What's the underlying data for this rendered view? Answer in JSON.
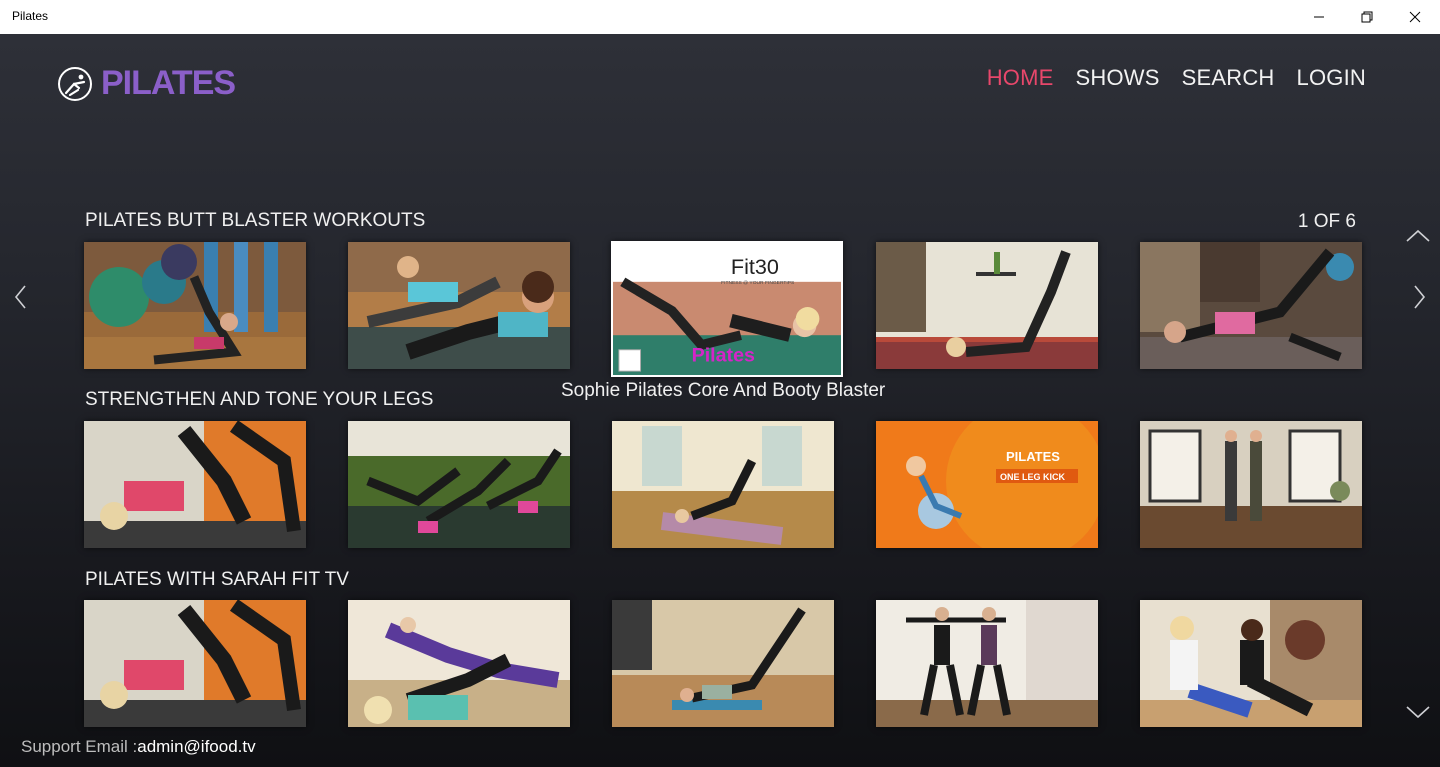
{
  "window": {
    "title": "Pilates"
  },
  "brand": {
    "name": "PILATES",
    "color": "#8b5fc9"
  },
  "nav": {
    "items": [
      {
        "label": "HOME",
        "active": true
      },
      {
        "label": "SHOWS",
        "active": false
      },
      {
        "label": "SEARCH",
        "active": false
      },
      {
        "label": "LOGIN",
        "active": false
      }
    ],
    "active_color": "#e8476b"
  },
  "pager": {
    "text": "1 OF 6"
  },
  "rows": [
    {
      "title": "PILATES BUTT BLASTER WORKOUTS"
    },
    {
      "title": "STRENGTHEN AND TONE YOUR LEGS"
    },
    {
      "title": "PILATES WITH SARAH FIT TV"
    }
  ],
  "featured": {
    "caption": "Sophie Pilates Core And Booty Blaster",
    "thumb_brand": "Fit30",
    "thumb_tagline": "FITNESS @ YOUR FINGERTIPS",
    "thumb_label": "Pilates"
  },
  "thumb_texts": {
    "pilates_title": "PILATES",
    "pilates_subtitle": "ONE LEG KICK"
  },
  "footer": {
    "label": "Support Email :",
    "email": "admin@ifood.tv"
  },
  "icons": {
    "logo": "gymnast-circle-icon",
    "left": "chevron-left-icon",
    "right": "chevron-right-icon",
    "up": "chevron-up-icon",
    "down": "chevron-down-icon"
  }
}
